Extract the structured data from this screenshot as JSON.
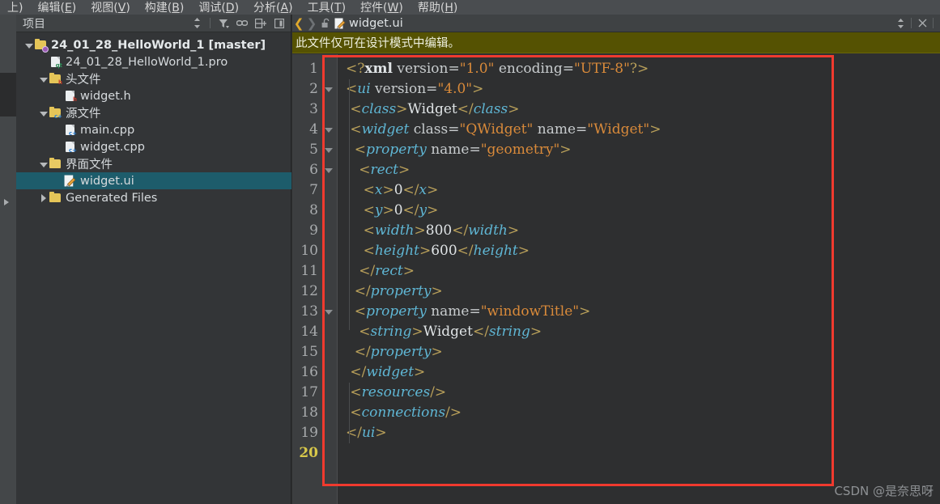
{
  "menubar": {
    "items": [
      {
        "label": "上)",
        "mnemonic": ""
      },
      {
        "label": "编辑(E)",
        "mnemonic": "E"
      },
      {
        "label": "视图(V)",
        "mnemonic": "V"
      },
      {
        "label": "构建(B)",
        "mnemonic": "B"
      },
      {
        "label": "调试(D)",
        "mnemonic": "D"
      },
      {
        "label": "分析(A)",
        "mnemonic": "A"
      },
      {
        "label": "工具(T)",
        "mnemonic": "T"
      },
      {
        "label": "控件(W)",
        "mnemonic": "W"
      },
      {
        "label": "帮助(H)",
        "mnemonic": "H"
      }
    ]
  },
  "project_panel": {
    "title": "项目",
    "tools": [
      {
        "name": "sync-selector-icon",
        "glyph": "⇕"
      },
      {
        "name": "filter-icon",
        "glyph": "▼"
      },
      {
        "name": "link-icon",
        "glyph": "⛓"
      },
      {
        "name": "split-icon",
        "glyph": "⊞"
      },
      {
        "name": "close-panel-icon",
        "glyph": "◧"
      }
    ],
    "tree": [
      {
        "label": "24_01_28_HelloWorld_1 [master]",
        "indent": 0,
        "twisty": "down",
        "icon": "project-folder-icon",
        "bold": true,
        "selected": false
      },
      {
        "label": "24_01_28_HelloWorld_1.pro",
        "indent": 1,
        "twisty": "none",
        "icon": "qt-pro-file-icon",
        "bold": false,
        "selected": false
      },
      {
        "label": "头文件",
        "indent": 1,
        "twisty": "down",
        "icon": "header-folder-icon",
        "bold": false,
        "selected": false
      },
      {
        "label": "widget.h",
        "indent": 2,
        "twisty": "none",
        "icon": "header-file-icon",
        "bold": false,
        "selected": false
      },
      {
        "label": "源文件",
        "indent": 1,
        "twisty": "down",
        "icon": "source-folder-icon",
        "bold": false,
        "selected": false
      },
      {
        "label": "main.cpp",
        "indent": 2,
        "twisty": "none",
        "icon": "cpp-file-icon",
        "bold": false,
        "selected": false
      },
      {
        "label": "widget.cpp",
        "indent": 2,
        "twisty": "none",
        "icon": "cpp-file-icon",
        "bold": false,
        "selected": false
      },
      {
        "label": "界面文件",
        "indent": 1,
        "twisty": "down",
        "icon": "ui-folder-icon",
        "bold": false,
        "selected": false
      },
      {
        "label": "widget.ui",
        "indent": 2,
        "twisty": "none",
        "icon": "ui-file-icon",
        "bold": false,
        "selected": true
      },
      {
        "label": "Generated Files",
        "indent": 1,
        "twisty": "right",
        "icon": "generated-folder-icon",
        "bold": false,
        "selected": false
      }
    ]
  },
  "editor": {
    "nav_back": "❮",
    "nav_forward": "❯",
    "lock_icon": "unlocked-icon",
    "file_icon": "ui-file-icon",
    "tab_name": "widget.ui",
    "tab_dropdown": "⇕",
    "tab_close": "✕",
    "notice": "此文件仅可在设计模式中编辑。",
    "active_line": 20,
    "fold_lines": [
      2,
      4,
      5,
      6,
      13
    ],
    "lines": [
      {
        "n": 1,
        "tokens": [
          {
            "t": "br",
            "v": "<?"
          },
          {
            "t": "kw",
            "v": "xml"
          },
          {
            "t": "at",
            "v": " version="
          },
          {
            "t": "vl",
            "v": "\"1.0\""
          },
          {
            "t": "at",
            "v": " encoding="
          },
          {
            "t": "vl",
            "v": "\"UTF-8\""
          },
          {
            "t": "br",
            "v": "?>"
          }
        ]
      },
      {
        "n": 2,
        "tokens": [
          {
            "t": "br",
            "v": "<"
          },
          {
            "t": "tg",
            "v": "ui"
          },
          {
            "t": "at",
            "v": " version="
          },
          {
            "t": "vl",
            "v": "\"4.0\""
          },
          {
            "t": "br",
            "v": ">"
          }
        ]
      },
      {
        "n": 3,
        "tokens": [
          {
            "t": "br",
            "v": " <"
          },
          {
            "t": "tg",
            "v": "class"
          },
          {
            "t": "br",
            "v": ">"
          },
          {
            "t": "tx",
            "v": "Widget"
          },
          {
            "t": "br",
            "v": "</"
          },
          {
            "t": "tg",
            "v": "class"
          },
          {
            "t": "br",
            "v": ">"
          }
        ]
      },
      {
        "n": 4,
        "tokens": [
          {
            "t": "br",
            "v": " <"
          },
          {
            "t": "tg",
            "v": "widget"
          },
          {
            "t": "at",
            "v": " class="
          },
          {
            "t": "vl",
            "v": "\"QWidget\""
          },
          {
            "t": "at",
            "v": " name="
          },
          {
            "t": "vl",
            "v": "\"Widget\""
          },
          {
            "t": "br",
            "v": ">"
          }
        ]
      },
      {
        "n": 5,
        "tokens": [
          {
            "t": "br",
            "v": "  <"
          },
          {
            "t": "tg",
            "v": "property"
          },
          {
            "t": "at",
            "v": " name="
          },
          {
            "t": "vl",
            "v": "\"geometry\""
          },
          {
            "t": "br",
            "v": ">"
          }
        ]
      },
      {
        "n": 6,
        "tokens": [
          {
            "t": "br",
            "v": "   <"
          },
          {
            "t": "tg",
            "v": "rect"
          },
          {
            "t": "br",
            "v": ">"
          }
        ]
      },
      {
        "n": 7,
        "tokens": [
          {
            "t": "br",
            "v": "    <"
          },
          {
            "t": "tg",
            "v": "x"
          },
          {
            "t": "br",
            "v": ">"
          },
          {
            "t": "tx",
            "v": "0"
          },
          {
            "t": "br",
            "v": "</"
          },
          {
            "t": "tg",
            "v": "x"
          },
          {
            "t": "br",
            "v": ">"
          }
        ]
      },
      {
        "n": 8,
        "tokens": [
          {
            "t": "br",
            "v": "    <"
          },
          {
            "t": "tg",
            "v": "y"
          },
          {
            "t": "br",
            "v": ">"
          },
          {
            "t": "tx",
            "v": "0"
          },
          {
            "t": "br",
            "v": "</"
          },
          {
            "t": "tg",
            "v": "y"
          },
          {
            "t": "br",
            "v": ">"
          }
        ]
      },
      {
        "n": 9,
        "tokens": [
          {
            "t": "br",
            "v": "    <"
          },
          {
            "t": "tg",
            "v": "width"
          },
          {
            "t": "br",
            "v": ">"
          },
          {
            "t": "tx",
            "v": "800"
          },
          {
            "t": "br",
            "v": "</"
          },
          {
            "t": "tg",
            "v": "width"
          },
          {
            "t": "br",
            "v": ">"
          }
        ]
      },
      {
        "n": 10,
        "tokens": [
          {
            "t": "br",
            "v": "    <"
          },
          {
            "t": "tg",
            "v": "height"
          },
          {
            "t": "br",
            "v": ">"
          },
          {
            "t": "tx",
            "v": "600"
          },
          {
            "t": "br",
            "v": "</"
          },
          {
            "t": "tg",
            "v": "height"
          },
          {
            "t": "br",
            "v": ">"
          }
        ]
      },
      {
        "n": 11,
        "tokens": [
          {
            "t": "br",
            "v": "   </"
          },
          {
            "t": "tg",
            "v": "rect"
          },
          {
            "t": "br",
            "v": ">"
          }
        ]
      },
      {
        "n": 12,
        "tokens": [
          {
            "t": "br",
            "v": "  </"
          },
          {
            "t": "tg",
            "v": "property"
          },
          {
            "t": "br",
            "v": ">"
          }
        ]
      },
      {
        "n": 13,
        "tokens": [
          {
            "t": "br",
            "v": "  <"
          },
          {
            "t": "tg",
            "v": "property"
          },
          {
            "t": "at",
            "v": " name="
          },
          {
            "t": "vl",
            "v": "\"windowTitle\""
          },
          {
            "t": "br",
            "v": ">"
          }
        ]
      },
      {
        "n": 14,
        "tokens": [
          {
            "t": "br",
            "v": "   <"
          },
          {
            "t": "tg",
            "v": "string"
          },
          {
            "t": "br",
            "v": ">"
          },
          {
            "t": "tx",
            "v": "Widget"
          },
          {
            "t": "br",
            "v": "</"
          },
          {
            "t": "tg",
            "v": "string"
          },
          {
            "t": "br",
            "v": ">"
          }
        ]
      },
      {
        "n": 15,
        "tokens": [
          {
            "t": "br",
            "v": "  </"
          },
          {
            "t": "tg",
            "v": "property"
          },
          {
            "t": "br",
            "v": ">"
          }
        ]
      },
      {
        "n": 16,
        "tokens": [
          {
            "t": "br",
            "v": " </"
          },
          {
            "t": "tg",
            "v": "widget"
          },
          {
            "t": "br",
            "v": ">"
          }
        ]
      },
      {
        "n": 17,
        "tokens": [
          {
            "t": "br",
            "v": " <"
          },
          {
            "t": "tg",
            "v": "resources"
          },
          {
            "t": "br",
            "v": "/>"
          }
        ]
      },
      {
        "n": 18,
        "tokens": [
          {
            "t": "br",
            "v": " <"
          },
          {
            "t": "tg",
            "v": "connections"
          },
          {
            "t": "br",
            "v": "/>"
          }
        ]
      },
      {
        "n": 19,
        "tokens": [
          {
            "t": "br",
            "v": "</"
          },
          {
            "t": "tg",
            "v": "ui"
          },
          {
            "t": "br",
            "v": ">"
          }
        ]
      },
      {
        "n": 20,
        "tokens": []
      }
    ]
  },
  "annotation": {
    "color": "#f03a2e",
    "shape": "rectangle"
  },
  "watermark": "CSDN @是奈思呀"
}
